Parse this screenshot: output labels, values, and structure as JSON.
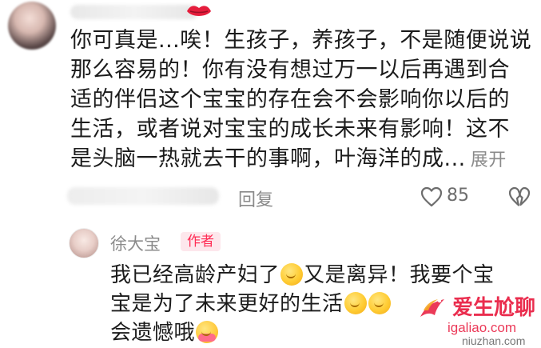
{
  "colors": {
    "text": "#1b1b1b",
    "muted": "#8a8a8a",
    "author_badge_bg": "#fde7ec",
    "author_badge_text": "#ff2d55",
    "watermark_red": "#e8173b"
  },
  "comment": {
    "lines": [
      "你可真是...唉！生孩子，养孩子，不是随便说说",
      "那么容易的！你有没有想过万一以后再遇到合",
      "适的伴侣这个宝宝的存在会不会影响你以后的",
      "生活，或者说对宝宝的成长未来有影响！这不",
      "是头脑一热就去干的事啊，叶海洋的成..."
    ],
    "expand_label": "展开",
    "reply_label": "回复",
    "like_count": "85",
    "icons": {
      "avatar": "blurred-avatar",
      "lips": "lips-icon",
      "like": "heart-outline-icon",
      "dislike": "broken-heart-icon"
    }
  },
  "reply": {
    "username": "徐大宝",
    "author_badge": "作者",
    "line1": "我已经高龄产妇了",
    "line1b": "又是离异！我要个宝",
    "line2": "宝是为了未来更好的生活",
    "line3": "会遗憾哦",
    "emojis": [
      "shy-smile-emoji",
      "shy-smile-emoji",
      "shy-smile-emoji",
      "hug-emoji"
    ]
  },
  "watermark": {
    "title": "爱生尬聊",
    "url1": "igaliao.com",
    "url2": "niuzhan.com"
  }
}
